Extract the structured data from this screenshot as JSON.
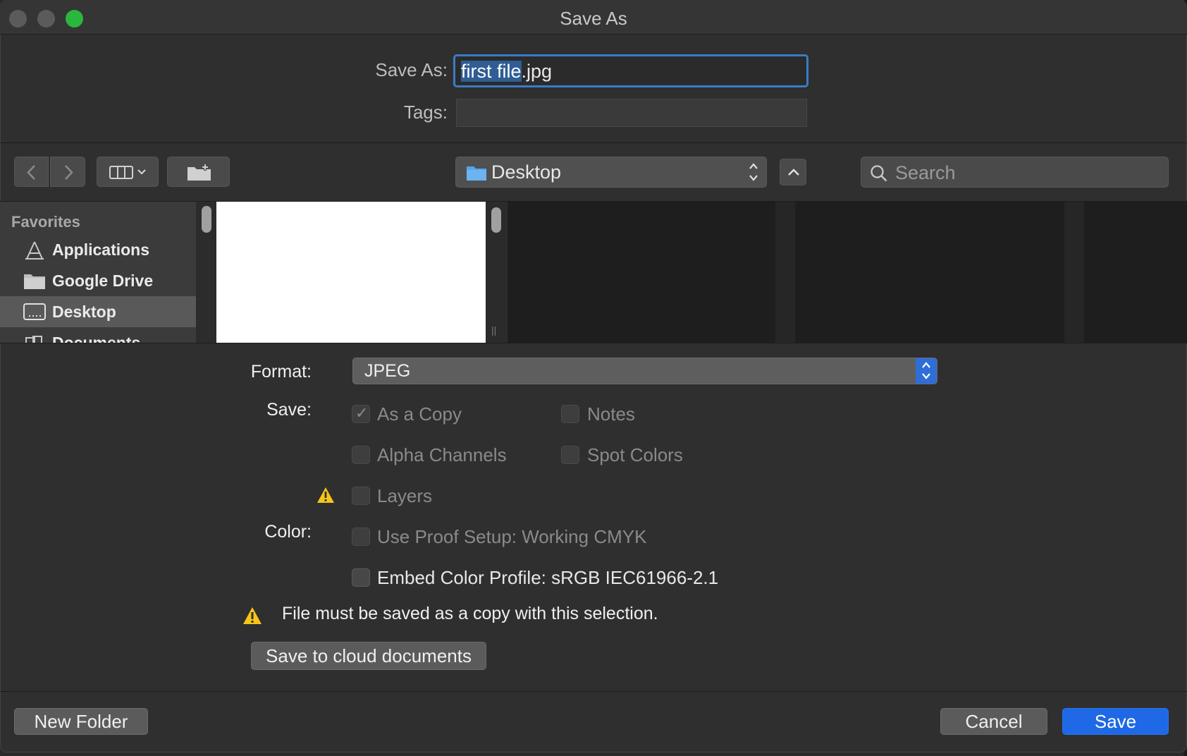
{
  "window": {
    "title": "Save As"
  },
  "form": {
    "save_as_label": "Save As:",
    "filename_selected": "first file",
    "filename_ext": ".jpg",
    "tags_label": "Tags:"
  },
  "toolbar": {
    "location": "Desktop",
    "search_placeholder": "Search"
  },
  "sidebar": {
    "header": "Favorites",
    "items": [
      {
        "label": "Applications",
        "icon": "applications-icon"
      },
      {
        "label": "Google Drive",
        "icon": "folder-icon"
      },
      {
        "label": "Desktop",
        "icon": "desktop-icon",
        "selected": true
      },
      {
        "label": "Documents",
        "icon": "documents-icon"
      }
    ]
  },
  "options": {
    "format_label": "Format:",
    "format_value": "JPEG",
    "save_label": "Save:",
    "color_label": "Color:",
    "as_a_copy": "As a Copy",
    "notes": "Notes",
    "alpha_channels": "Alpha Channels",
    "spot_colors": "Spot Colors",
    "layers": "Layers",
    "use_proof_setup": "Use Proof Setup:  Working CMYK",
    "embed_color_profile": "Embed Color Profile:  sRGB IEC61966-2.1",
    "warning_message": "File must be saved as a copy with this selection.",
    "cloud_button": "Save to cloud documents"
  },
  "buttons": {
    "new_folder": "New Folder",
    "cancel": "Cancel",
    "save": "Save"
  },
  "colors": {
    "accent": "#1f68e6",
    "zoom_green": "#2ab73e",
    "warning_yellow": "#f5c518"
  }
}
